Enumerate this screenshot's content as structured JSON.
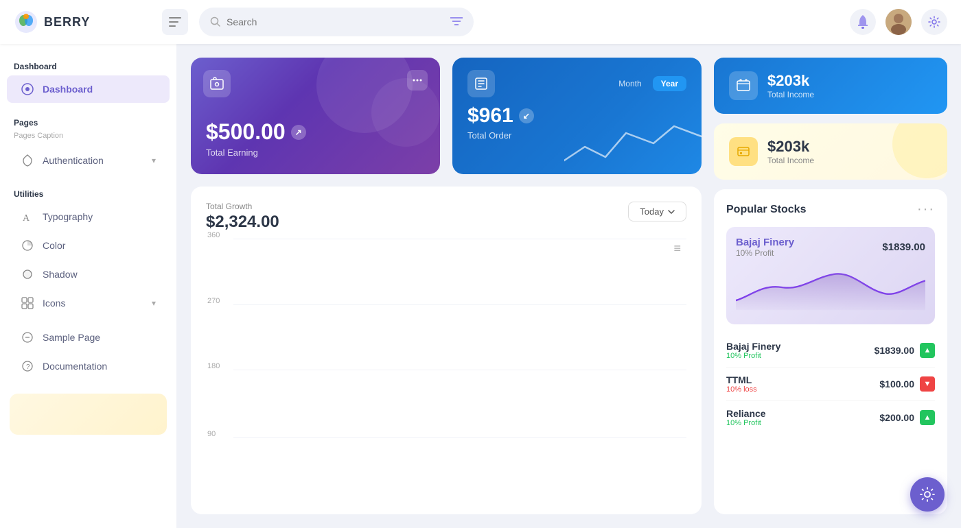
{
  "header": {
    "logo_text": "BERRY",
    "search_placeholder": "Search",
    "menu_icon": "☰"
  },
  "sidebar": {
    "dashboard_section": "Dashboard",
    "dashboard_item": "Dashboard",
    "pages_section": "Pages",
    "pages_caption": "Pages Caption",
    "authentication_item": "Authentication",
    "utilities_section": "Utilities",
    "typography_item": "Typography",
    "color_item": "Color",
    "shadow_item": "Shadow",
    "icons_item": "Icons",
    "sample_page_item": "Sample Page",
    "documentation_item": "Documentation"
  },
  "cards": {
    "earning_amount": "$500.00",
    "earning_label": "Total Earning",
    "order_amount": "$961",
    "order_label": "Total Order",
    "month_tab": "Month",
    "year_tab": "Year",
    "income_blue_amount": "$203k",
    "income_blue_label": "Total Income",
    "income_yellow_amount": "$203k",
    "income_yellow_label": "Total Income"
  },
  "chart": {
    "title": "Total Growth",
    "amount": "$2,324.00",
    "filter_label": "Today",
    "y_labels": [
      "360",
      "270",
      "180",
      "90"
    ],
    "menu_icon": "≡"
  },
  "stocks": {
    "title": "Popular Stocks",
    "banner_name": "Bajaj Finery",
    "banner_price": "$1839.00",
    "banner_profit": "10% Profit",
    "items": [
      {
        "name": "Bajaj Finery",
        "profit": "10% Profit",
        "profit_type": "green",
        "price": "$1839.00",
        "trend": "up"
      },
      {
        "name": "TTML",
        "profit": "10% loss",
        "profit_type": "red",
        "price": "$100.00",
        "trend": "down"
      },
      {
        "name": "Reliance",
        "profit": "10% Profit",
        "profit_type": "green",
        "price": "$200.00",
        "trend": "up"
      }
    ]
  },
  "fab": {
    "icon": "⚙"
  }
}
